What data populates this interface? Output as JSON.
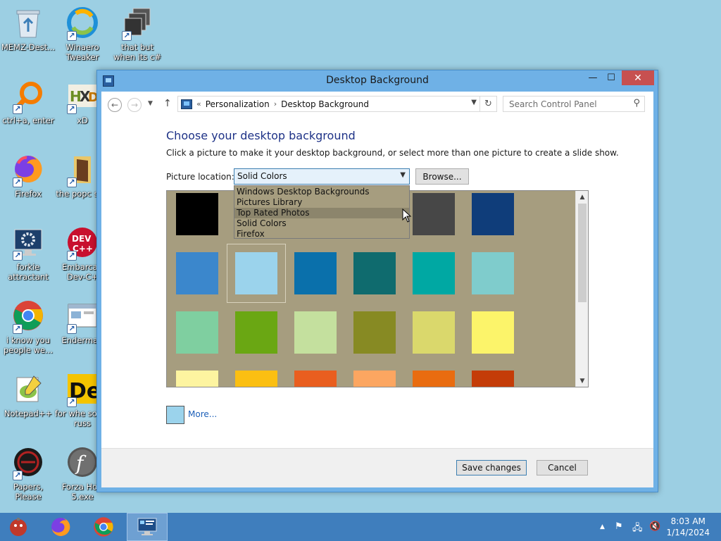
{
  "desktop": {
    "icons": [
      {
        "label": "MEMZ-Dest...",
        "icon": "recycle-bin-icon"
      },
      {
        "label": "Winaero Tweaker",
        "icon": "winaero-icon"
      },
      {
        "label": "that but when its c#",
        "icon": "stack-icon"
      },
      {
        "label": "ctrl+a, enter",
        "icon": "magnifier-icon"
      },
      {
        "label": "xD",
        "icon": "hxd-icon"
      },
      {
        "label": "Firefox",
        "icon": "firefox-icon"
      },
      {
        "label": "the popc shit",
        "icon": "folder-icon"
      },
      {
        "label": "forkie attractant",
        "icon": "monitor-gear-icon"
      },
      {
        "label": "Embarcad Dev-C+",
        "icon": "devcpp-icon"
      },
      {
        "label": "i know you people we...",
        "icon": "chrome-icon"
      },
      {
        "label": "Enderman",
        "icon": "window-icon"
      },
      {
        "label": "Notepad++",
        "icon": "notepadpp-icon"
      },
      {
        "label": "for whe some russ",
        "icon": "de-icon"
      },
      {
        "label": "Papers, Please",
        "icon": "papers-please-icon"
      },
      {
        "label": "Forza Hori 5.exe",
        "icon": "flash-icon"
      }
    ]
  },
  "window": {
    "title": "Desktop Background",
    "controls": {
      "minimize": "—",
      "maximize": "☐",
      "close": "✕"
    },
    "address": {
      "prefix": "«",
      "crumbs": [
        "Personalization",
        "Desktop Background"
      ],
      "separator": "›"
    },
    "search_placeholder": "Search Control Panel",
    "heading": "Choose your desktop background",
    "subtext": "Click a picture to make it your desktop background, or select more than one picture to create a slide show.",
    "location_label": "Picture location:",
    "location_value": "Solid Colors",
    "browse_label": "Browse...",
    "dropdown_options": [
      "Windows Desktop Backgrounds",
      "Pictures Library",
      "Top Rated Photos",
      "Solid Colors",
      "Firefox"
    ],
    "hovered_option": "Top Rated Photos",
    "swatch_rows": [
      [
        "#000000",
        "#474747",
        "#474747",
        "#474747",
        "#474747",
        "#0f3d7a"
      ],
      [
        "#3b87cc",
        "#9bd3ec",
        "#0a70ab",
        "#0f6b6e",
        "#00a8a3",
        "#7fcccc"
      ],
      [
        "#7fcfa0",
        "#6aa713",
        "#c4e09e",
        "#878a23",
        "#dad86c",
        "#fcf46a"
      ],
      [
        "#fdf4a0",
        "#fbbf12",
        "#e95e1f",
        "#fca661",
        "#e96c10",
        "#c43c08"
      ]
    ],
    "selected_color": "#9bd3ec",
    "more_label": "More...",
    "save_label": "Save changes",
    "cancel_label": "Cancel"
  },
  "taskbar": {
    "items": [
      "memz-icon",
      "firefox-icon",
      "chrome-icon",
      "control-panel-icon"
    ],
    "time": "8:03 AM",
    "date": "1/14/2024"
  }
}
